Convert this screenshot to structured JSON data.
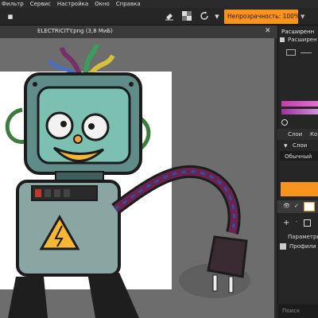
{
  "menu": [
    "Фильтр",
    "Сервис",
    "Настройка",
    "Окно",
    "Справка"
  ],
  "toolbar": {
    "opacity_label": "Непрозрачность: 100%",
    "icons": [
      "eraser-icon",
      "checker-icon",
      "rotate-icon",
      "dropdown-chevron-icon"
    ]
  },
  "document": {
    "title": "ELECTRICITY.png (3,8 МиБ)",
    "close_glyph": "✕"
  },
  "panel": {
    "header": "Расширенн",
    "item1": "Расширен",
    "tab_layers": "Слои",
    "tab_other": "Ко",
    "layers_dropdown": "Слои",
    "blend_mode": "Обычный",
    "params_label": "Параметры",
    "profile_label": "Профили",
    "search_placeholder": "Поиск"
  },
  "colors": {
    "accent": "#f7941d",
    "canvas_bg": "#6d6d6d",
    "panel_bg": "#262626"
  }
}
